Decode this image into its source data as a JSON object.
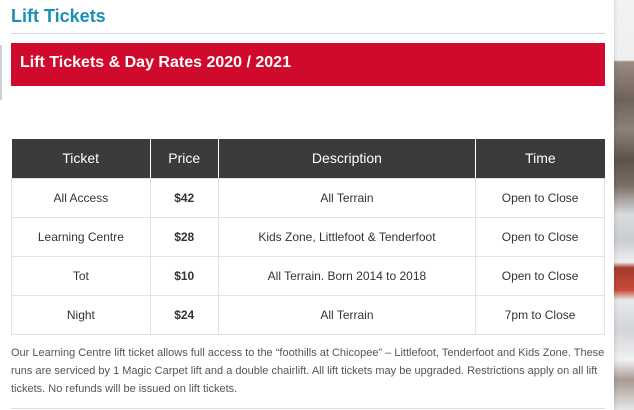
{
  "page": {
    "title": "Lift Tickets",
    "banner": "Lift Tickets & Day Rates 2020 / 2021"
  },
  "table": {
    "headers": [
      "Ticket",
      "Price",
      "Description",
      "Time"
    ],
    "rows": [
      {
        "ticket": "All Access",
        "price": "$42",
        "description": "All Terrain",
        "time": "Open to Close"
      },
      {
        "ticket": "Learning Centre",
        "price": "$28",
        "description": "Kids Zone, Littlefoot & Tenderfoot",
        "time": "Open to Close"
      },
      {
        "ticket": "Tot",
        "price": "$10",
        "description": "All Terrain. Born 2014 to 2018",
        "time": "Open to Close"
      },
      {
        "ticket": "Night",
        "price": "$24",
        "description": "All Terrain",
        "time": "7pm to Close"
      }
    ]
  },
  "note": "Our Learning Centre lift ticket allows full access to the “foothills at Chicopee” – Littlefoot, Tenderfoot and Kids Zone. These runs are serviced by 1 Magic Carpet lift and a double chairlift. All lift tickets may be upgraded. Restrictions apply on all lift tickets. No refunds will be issued on lift tickets.",
  "colors": {
    "title": "#1b8fb5",
    "banner_bg": "#cf0a2c",
    "header_bg": "#3b3b3b"
  }
}
